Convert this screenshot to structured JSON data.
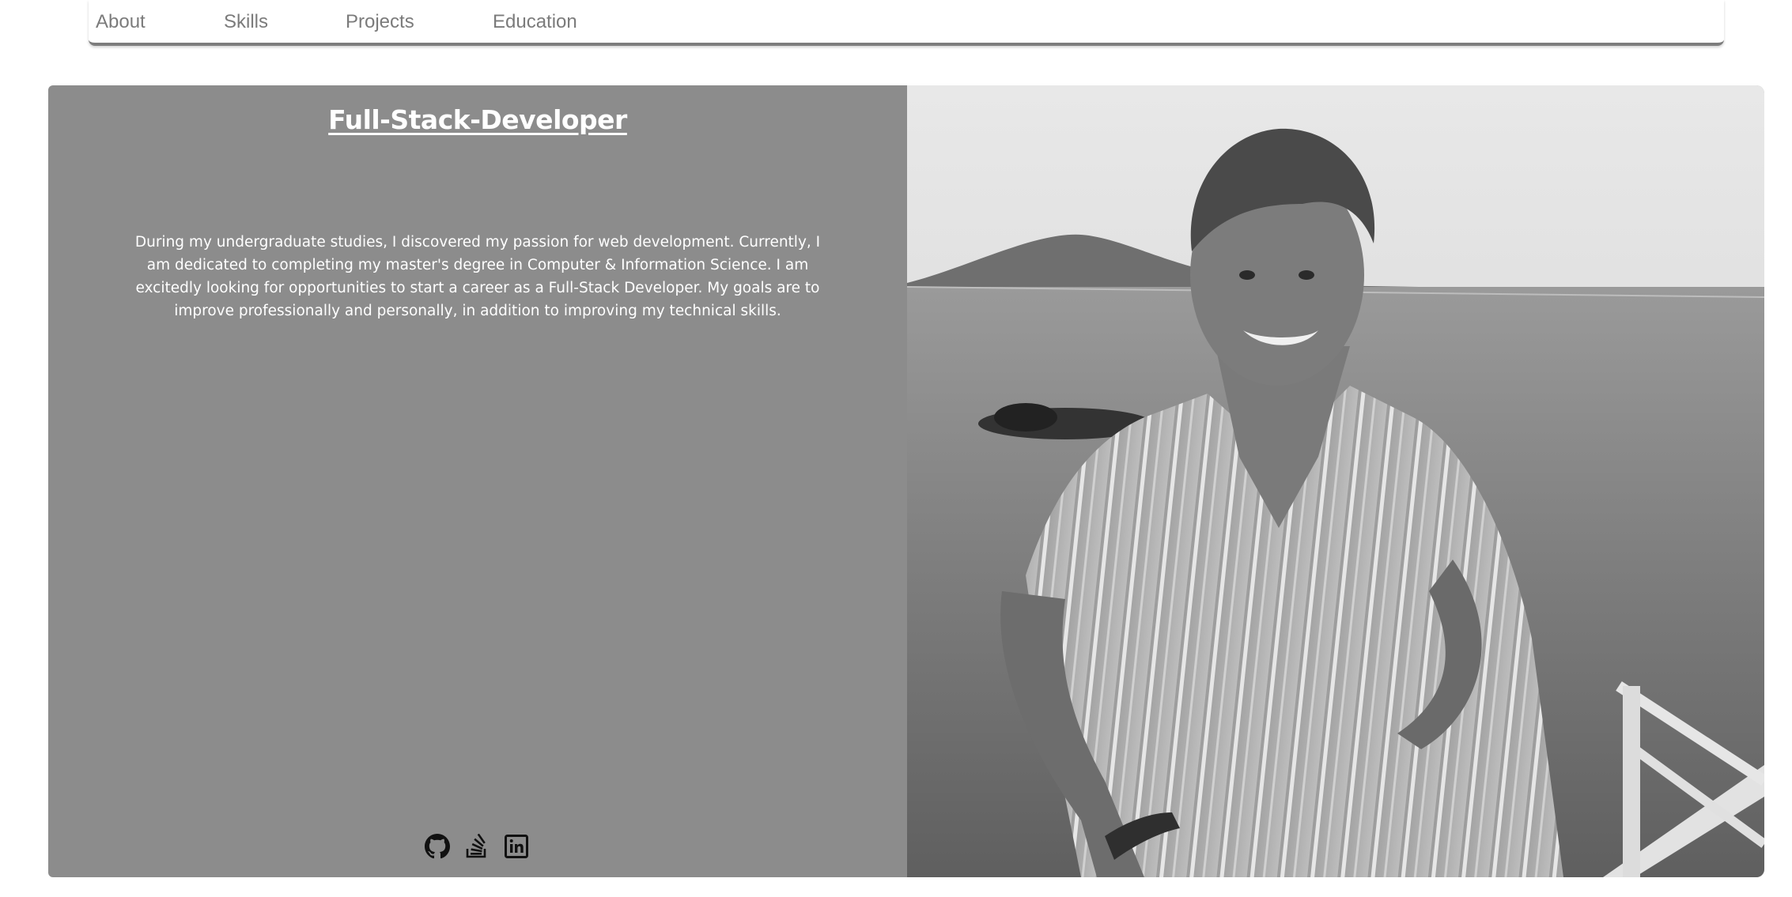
{
  "nav": {
    "items": [
      {
        "label": "About"
      },
      {
        "label": "Skills"
      },
      {
        "label": "Projects"
      },
      {
        "label": "Education"
      }
    ]
  },
  "hero": {
    "title": "Full-Stack-Developer",
    "bio": "During my undergraduate studies, I discovered my passion for web development. Currently, I am dedicated to completing my master's degree in Computer & Information Science. I am excitedly looking for opportunities to start a career as a Full-Stack Developer. My goals are to improve professionally and personally, in addition to improving my technical skills.",
    "socials": [
      {
        "icon": "github-icon"
      },
      {
        "icon": "stackoverflow-icon"
      },
      {
        "icon": "linkedin-icon"
      }
    ]
  },
  "colors": {
    "panel_bg": "#8c8c8c",
    "nav_text": "#7b7b7b",
    "nav_underline": "#7d7d7d",
    "text_on_panel": "#ffffff",
    "icon": "#111111"
  }
}
